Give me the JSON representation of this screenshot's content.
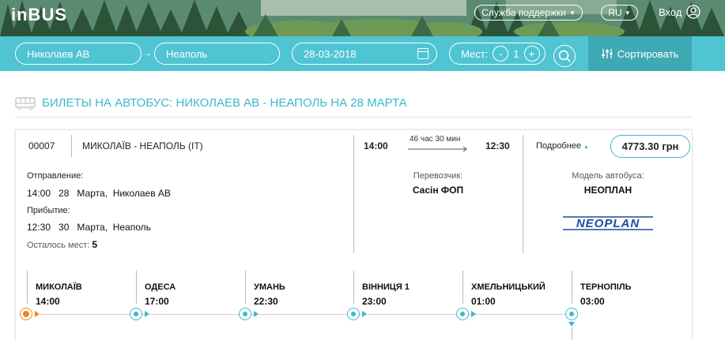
{
  "header": {
    "logo": "inBUS",
    "support_label": "Служба поддержки",
    "language": "RU",
    "login_label": "Вход"
  },
  "search": {
    "from": "Николаев АВ",
    "to": "Неаполь",
    "date": "28-03-2018",
    "seats_label": "Мест:",
    "seats_value": "1",
    "minus": "-",
    "plus": "+",
    "sort_label": "Сортировать"
  },
  "page_title": "БИЛЕТЫ НА АВТОБУС: НИКОЛАЕВ АВ - НЕАПОЛЬ НА 28 МАРТА",
  "ticket": {
    "number": "00007",
    "route": "МИКОЛАЇВ - НЕАПОЛЬ (IT)",
    "departure_time": "14:00",
    "duration": "46 час 30 мин",
    "arrival_time": "12:30",
    "more_label": "Подробнее",
    "price": "4773.30 грн",
    "departure_label": "Отправление:",
    "departure_detail": {
      "time": "14:00",
      "day": "28",
      "month": "Марта,",
      "place": "Николаев АВ"
    },
    "arrival_label": "Прибытие:",
    "arrival_detail": {
      "time": "12:30",
      "day": "30",
      "month": "Марта,",
      "place": "Неаполь"
    },
    "seats_left_label": "Осталось мест:",
    "seats_left": "5",
    "carrier_label": "Перевозчик:",
    "carrier": "Сасін ФОП",
    "bus_model_label": "Модель автобуса:",
    "bus_model": "НЕОПЛАН",
    "bus_logo_text": "NEOPLAN"
  },
  "stops": [
    {
      "name": "МИКОЛАЇВ",
      "time": "14:00"
    },
    {
      "name": "ОДЕСА",
      "time": "17:00"
    },
    {
      "name": "УМАНЬ",
      "time": "22:30"
    },
    {
      "name": "ВІННИЦЯ 1",
      "time": "23:00"
    },
    {
      "name": "ХМЕЛЬНИЦЬКИЙ",
      "time": "01:00"
    },
    {
      "name": "ТЕРНОПІЛЬ",
      "time": "03:00"
    }
  ],
  "colors": {
    "accent": "#4fc4d2",
    "accent_dark": "#3ea9b3",
    "title": "#3cbac8",
    "origin_dot": "#f0861e",
    "neoplan_blue": "#1d4aa0"
  }
}
